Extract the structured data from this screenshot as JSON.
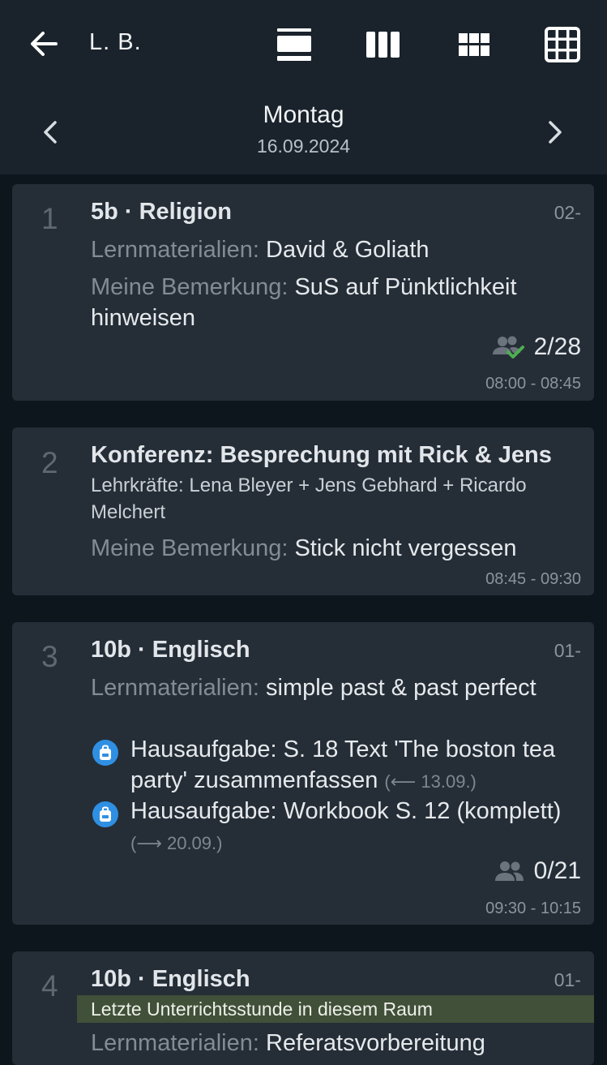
{
  "header": {
    "user_name": "L. B.",
    "back_icon": "arrow-left-icon",
    "view_icons": [
      "view-rows-icon",
      "view-columns-icon",
      "view-grid-small-icon",
      "view-grid-large-icon"
    ]
  },
  "day_nav": {
    "day_name": "Montag",
    "date": "16.09.2024"
  },
  "colors": {
    "header_bg": "#1a232c",
    "page_bg": "#0d151d",
    "card_bg": "#252e37",
    "check_green": "#4caf50",
    "homework_blue": "#2f8fe3",
    "banner_green": "#415038"
  },
  "lessons": [
    {
      "number": "1",
      "title": "5b · Religion",
      "room": "02-",
      "materials_label": "Lernmaterialien:",
      "materials": "David & Goliath",
      "remark_label": "Meine Bemerkung:",
      "remark": "SuS auf Pünktlichkeit hinweisen",
      "attendance": "2/28",
      "attendance_icon": "group-check-icon",
      "time": "08:00 - 08:45"
    },
    {
      "number": "2",
      "title": "Konferenz: Besprechung mit Rick & Jens",
      "teachers": "Lehrkräfte: Lena Bleyer + Jens Gebhard + Ricardo Melchert",
      "remark_label": "Meine Bemerkung:",
      "remark": "Stick nicht vergessen",
      "time": "08:45 - 09:30"
    },
    {
      "number": "3",
      "title": "10b · Englisch",
      "room": "01-",
      "materials_label": "Lernmaterialien:",
      "materials": "simple past & past perfect",
      "homework": [
        {
          "icon": "backpack-icon",
          "text": "Hausaufgabe: S. 18 Text 'The boston tea party' zusammenfassen",
          "date": "(⟵ 13.09.)"
        },
        {
          "icon": "backpack-icon",
          "text": "Hausaufgabe: Workbook S. 12 (komplett)",
          "date": "(⟶ 20.09.)"
        }
      ],
      "attendance": "0/21",
      "attendance_icon": "group-icon",
      "time": "09:30 - 10:15"
    },
    {
      "number": "4",
      "title": "10b · Englisch",
      "room": "01-",
      "banner": "Letzte Unterrichtsstunde in diesem Raum",
      "materials_label": "Lernmaterialien:",
      "materials": "Referatsvorbereitung"
    }
  ]
}
